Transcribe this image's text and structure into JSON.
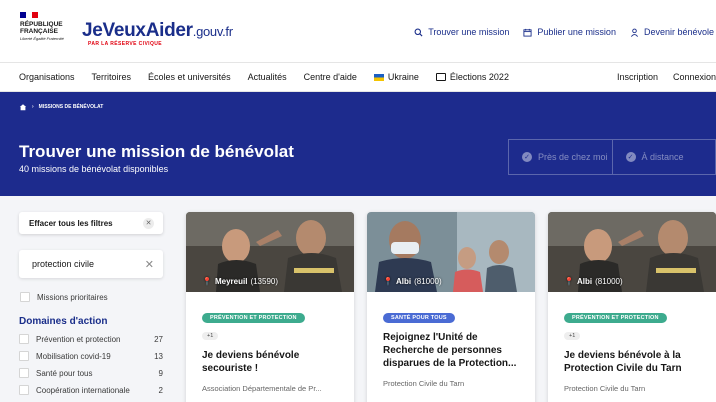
{
  "header": {
    "rf_name": "République Française",
    "rf_motto": "Liberté Égalité Fraternité",
    "brand_part1": "JeVeuxAider",
    "brand_part2": ".gouv.fr",
    "brand_tagline": "PAR LA RÉSERVE CIVIQUE",
    "links": {
      "find": "Trouver une mission",
      "publish": "Publier une mission",
      "become": "Devenir bénévole"
    }
  },
  "nav": {
    "items": [
      "Organisations",
      "Territoires",
      "Écoles et universités",
      "Actualités",
      "Centre d'aide"
    ],
    "ukraine": "Ukraine",
    "elections": "Élections 2022",
    "inscription": "Inscription",
    "connexion": "Connexion"
  },
  "hero": {
    "breadcrumb": "Missions de bénévolat",
    "title": "Trouver une mission de bénévolat",
    "subtitle": "40 missions de bénévolat disponibles",
    "near_me": "Près de chez moi",
    "remote": "À distance"
  },
  "filters": {
    "clear_all": "Effacer tous les filtres",
    "search_value": "protection civile",
    "priority": "Missions prioritaires",
    "domains_title": "Domaines d'action",
    "domains": [
      {
        "label": "Prévention et protection",
        "count": "27"
      },
      {
        "label": "Mobilisation covid-19",
        "count": "13"
      },
      {
        "label": "Santé pour tous",
        "count": "9"
      },
      {
        "label": "Coopération internationale",
        "count": "2"
      }
    ]
  },
  "cards": [
    {
      "location_city": "Meyreuil",
      "location_code": "(13590)",
      "tag": "Prévention et protection",
      "tag_color": "#3dab8e",
      "extra": "+1",
      "title": "Je deviens bénévole secouriste !",
      "org": "Association Départementale de Pr..."
    },
    {
      "location_city": "Albi",
      "location_code": "(81000)",
      "tag": "Santé pour tous",
      "tag_color": "#4a6bd4",
      "extra": "",
      "title": "Rejoignez l'Unité de Recherche de personnes disparues de la Protection...",
      "org": "Protection Civile du Tarn"
    },
    {
      "location_city": "Albi",
      "location_code": "(81000)",
      "tag": "Prévention et protection",
      "tag_color": "#3dab8e",
      "extra": "+1",
      "title": "Je deviens bénévole à la Protection Civile du Tarn",
      "org": "Protection Civile du Tarn"
    }
  ],
  "colors": {
    "primary_blue": "#1d2b8d",
    "brand_red": "#e1000f"
  }
}
